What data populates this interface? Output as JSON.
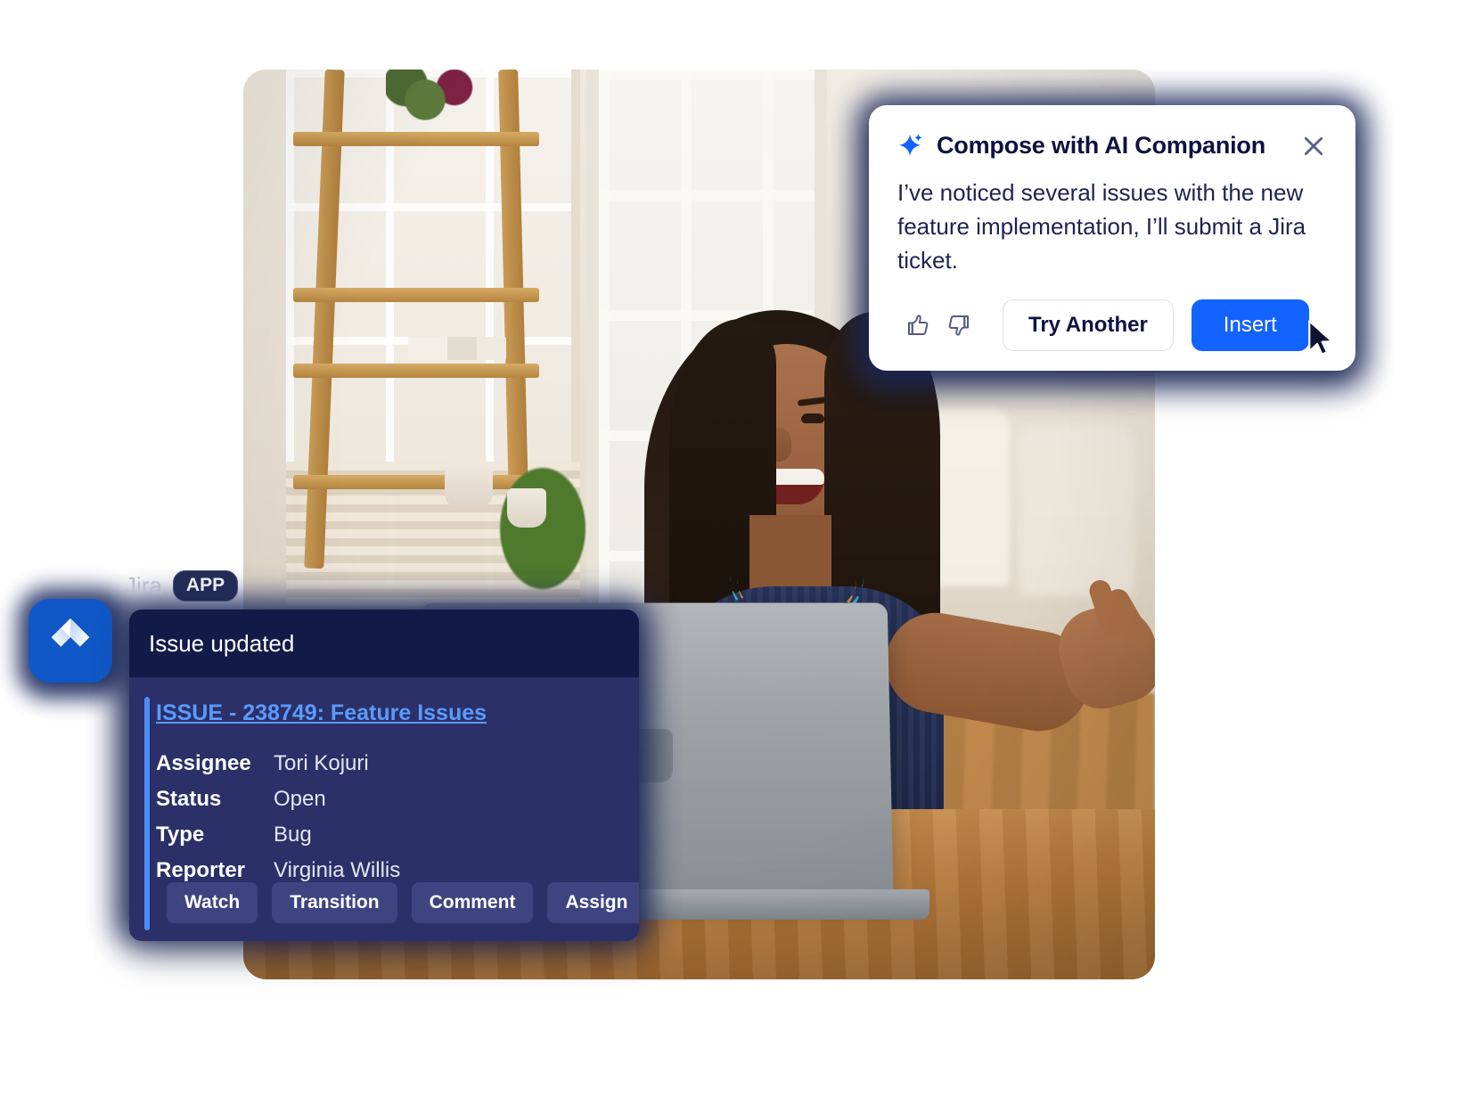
{
  "ai_card": {
    "sparkle_icon": "sparkle-icon",
    "title": "Compose with AI Companion",
    "close_icon": "close-icon",
    "message": "I’ve noticed several issues with the new feature implementation, I’ll submit a Jira ticket.",
    "thumbs_up_icon": "thumbs-up-icon",
    "thumbs_down_icon": "thumbs-down-icon",
    "try_another_label": "Try Another",
    "insert_label": "Insert",
    "cursor_icon": "cursor-arrow-icon",
    "colors": {
      "accent_blue": "#1263ff",
      "title_navy": "#0d1240",
      "body_navy": "#1d2352",
      "card_bg": "#ffffff"
    }
  },
  "jira_card": {
    "app_name": "Jira",
    "app_badge": "APP",
    "logo_icon": "jira-logo-icon",
    "header_title": "Issue updated",
    "issue_link": "ISSUE - 238749: Feature Issues",
    "fields": [
      {
        "label": "Assignee",
        "value": "Tori Kojuri"
      },
      {
        "label": "Status",
        "value": "Open"
      },
      {
        "label": "Type",
        "value": "Bug"
      },
      {
        "label": "Reporter",
        "value": "Virginia Willis"
      }
    ],
    "buttons": [
      "Watch",
      "Transition",
      "Comment",
      "Assign"
    ],
    "colors": {
      "header_bg": "#121a47",
      "body_bg": "#2b3068",
      "accent_bar": "#4c8ef7",
      "link": "#5b9afc",
      "button_bg": "#3e4480",
      "logo_bg": "#1058c7"
    }
  },
  "photo": {
    "alt": "Woman smiling at laptop in bright home office"
  }
}
